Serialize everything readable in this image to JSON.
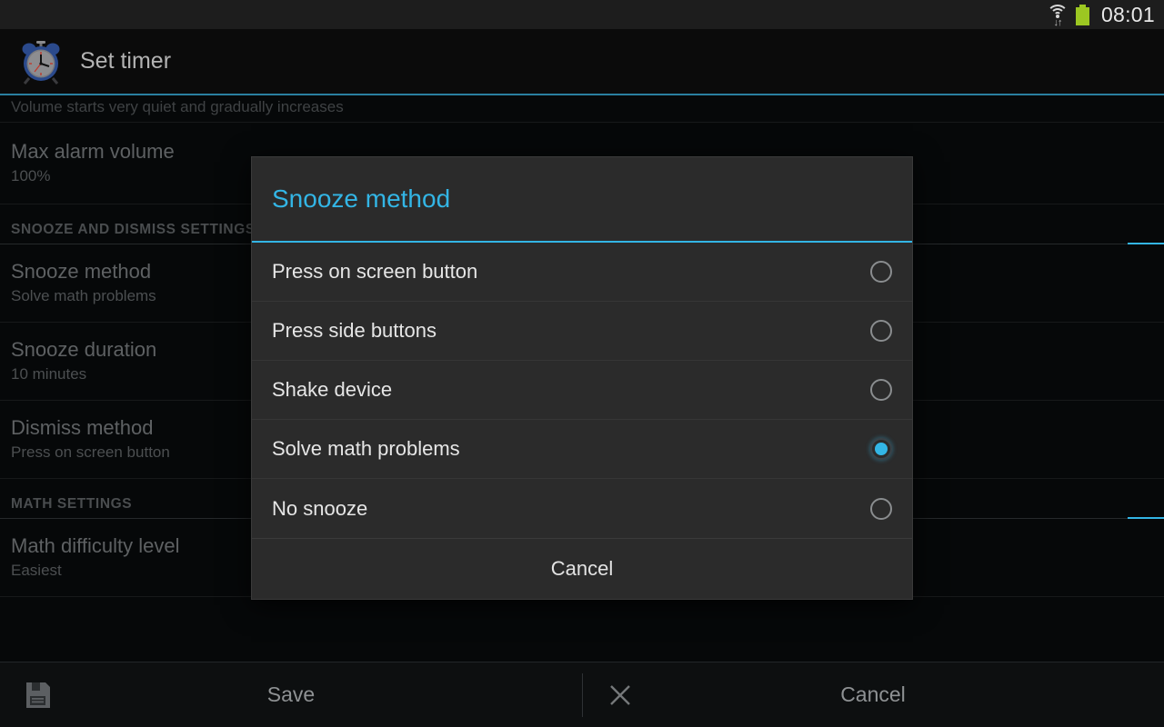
{
  "status_bar": {
    "time": "08:01",
    "wifi_icon": "wifi-icon",
    "wifi_transfer": "↓↑",
    "battery_icon": "battery-full-icon"
  },
  "app_bar": {
    "icon": "alarm-clock-icon",
    "title": "Set timer"
  },
  "settings_list": {
    "clipped_summary": "Volume starts very quiet and gradually increases",
    "items": [
      {
        "kind": "pref",
        "title": "Max alarm volume",
        "summary": "100%"
      },
      {
        "kind": "section",
        "title": "SNOOZE AND DISMISS SETTINGS"
      },
      {
        "kind": "pref",
        "title": "Snooze method",
        "summary": "Solve math problems"
      },
      {
        "kind": "pref",
        "title": "Snooze duration",
        "summary": "10 minutes"
      },
      {
        "kind": "pref",
        "title": "Dismiss method",
        "summary": "Press on screen button"
      },
      {
        "kind": "section",
        "title": "MATH SETTINGS"
      },
      {
        "kind": "pref",
        "title": "Math difficulty level",
        "summary": "Easiest"
      }
    ]
  },
  "dialog": {
    "title": "Snooze method",
    "options": [
      {
        "label": "Press on screen button",
        "selected": false
      },
      {
        "label": "Press side buttons",
        "selected": false
      },
      {
        "label": "Shake device",
        "selected": false
      },
      {
        "label": "Solve math problems",
        "selected": true
      },
      {
        "label": "No snooze",
        "selected": false
      }
    ],
    "cancel_label": "Cancel"
  },
  "bottom_bar": {
    "save_icon": "save-floppy-icon",
    "save_label": "Save",
    "cancel_icon": "close-x-icon",
    "cancel_label": "Cancel"
  },
  "colors": {
    "accent": "#33b5e5",
    "dialog_bg": "#2b2b2b",
    "screen_bg": "#060809",
    "battery": "#9cc722"
  }
}
